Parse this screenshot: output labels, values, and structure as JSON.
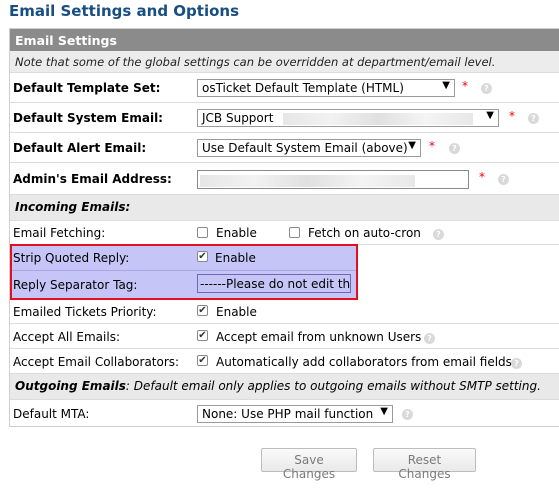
{
  "page": {
    "title": "Email Settings and Options"
  },
  "header": {
    "section_title": "Email Settings",
    "note": "Note that some of the global settings can be overridden at department/email level."
  },
  "fields": {
    "template_set": {
      "label": "Default Template Set:",
      "value": "osTicket Default Template (HTML)",
      "required": "*"
    },
    "system_email": {
      "label": "Default System Email:",
      "value": "JCB Support",
      "required": "*"
    },
    "alert_email": {
      "label": "Default Alert Email:",
      "value": "Use Default System Email (above)",
      "required": "*"
    },
    "admin_email": {
      "label": "Admin's Email Address:",
      "value": "",
      "required": "*"
    }
  },
  "incoming": {
    "title": "Incoming Emails:",
    "fetching": {
      "label": "Email Fetching:",
      "enable": "Enable",
      "auto_cron": "Fetch on auto-cron"
    },
    "strip_quoted": {
      "label": "Strip Quoted Reply:",
      "enable": "Enable"
    },
    "reply_separator": {
      "label": "Reply Separator Tag:",
      "value": "------Please do not edit the"
    },
    "tickets_priority": {
      "label": "Emailed Tickets Priority:",
      "enable": "Enable"
    },
    "accept_all": {
      "label": "Accept All Emails:",
      "option": "Accept email from unknown Users"
    },
    "collaborators": {
      "label": "Accept Email Collaborators:",
      "option": "Automatically add collaborators from email fields"
    }
  },
  "outgoing": {
    "title": "Outgoing Emails",
    "note": ": Default email only applies to outgoing emails without SMTP setting.",
    "mta": {
      "label": "Default MTA:",
      "value": "None: Use PHP mail function"
    }
  },
  "buttons": {
    "save": "Save Changes",
    "reset": "Reset Changes"
  },
  "icons": {
    "help": "help-circle-icon",
    "dropdown": "chevron-down-icon",
    "checkmark": "check-icon"
  },
  "colors": {
    "title": "#184e81",
    "header": "#8b8b8b",
    "highlight": "#c5c5f7",
    "highlight_border": "#e0101e",
    "required": "#e00000"
  }
}
